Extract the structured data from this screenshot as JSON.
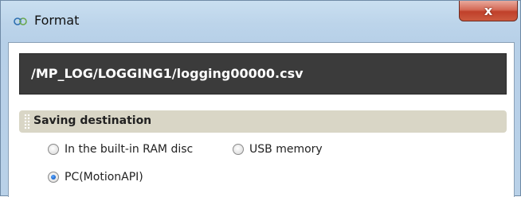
{
  "window": {
    "title": "Format",
    "close_label": "x"
  },
  "path": {
    "value": "/MP_LOG/LOGGING1/logging00000.csv"
  },
  "saving_destination": {
    "title": "Saving destination",
    "options": [
      {
        "label": "In the built-in RAM disc",
        "selected": false
      },
      {
        "label": "USB memory",
        "selected": false
      },
      {
        "label": "PC(MotionAPI)",
        "selected": true
      }
    ]
  },
  "colors": {
    "path_bar_bg": "#3b3b3b",
    "section_header_bg": "#d9d6c6",
    "close_button": "#c0402a",
    "radio_selected": "#1a64c8"
  }
}
